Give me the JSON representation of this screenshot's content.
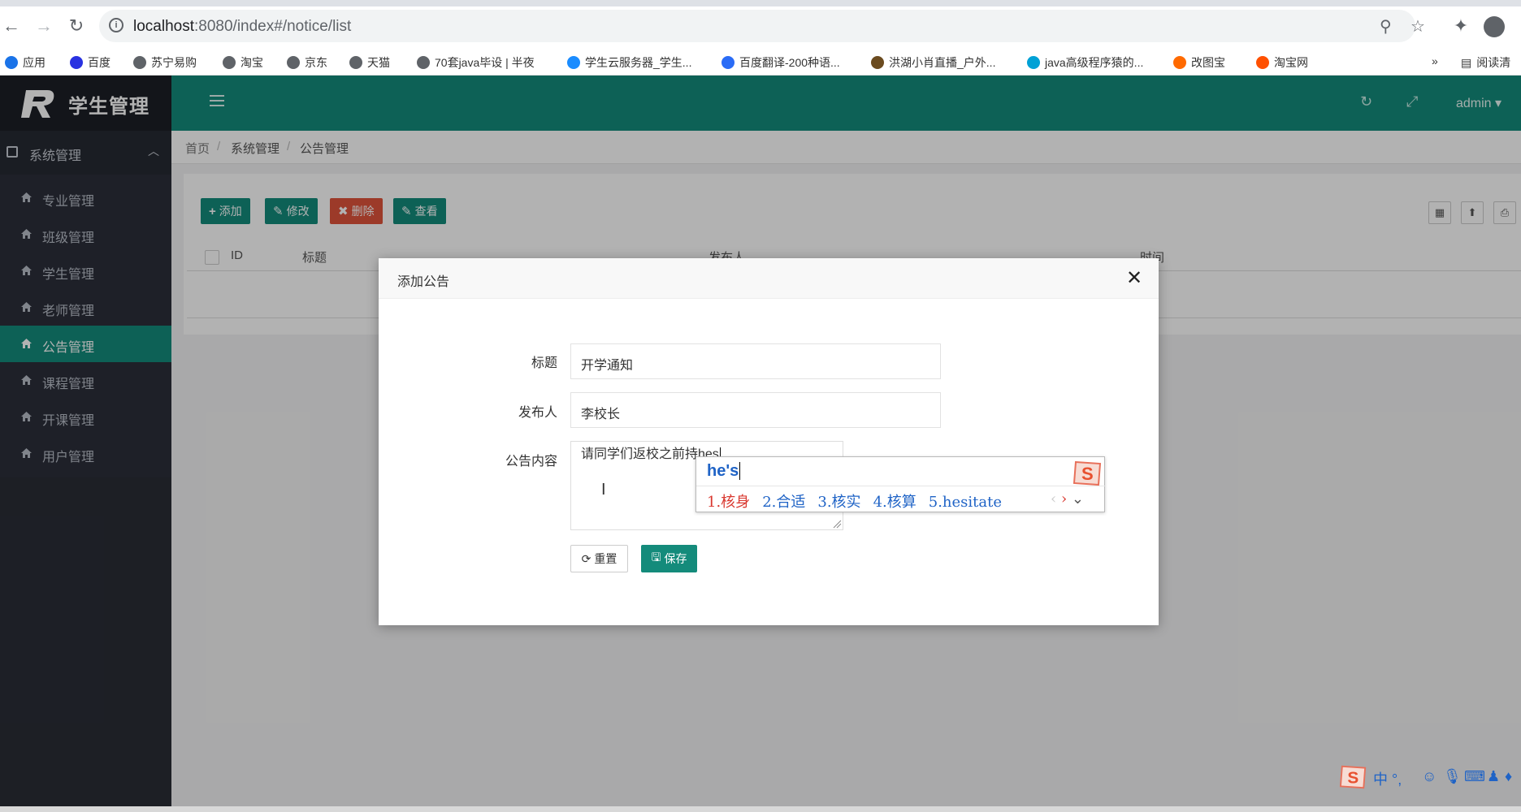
{
  "browser": {
    "url_host": "localhost",
    "url_path": ":8080/index#/notice/list",
    "bookmarks": [
      {
        "label": "应用",
        "icon": "apps-grid-icon",
        "color": "#1a73e8"
      },
      {
        "label": "百度",
        "icon": "baidu-paw-icon",
        "color": "#2932e1"
      },
      {
        "label": "苏宁易购",
        "icon": "globe-icon",
        "color": "#5f6368"
      },
      {
        "label": "淘宝",
        "icon": "globe-icon",
        "color": "#5f6368"
      },
      {
        "label": "京东",
        "icon": "globe-icon",
        "color": "#5f6368"
      },
      {
        "label": "天猫",
        "icon": "globe-icon",
        "color": "#5f6368"
      },
      {
        "label": "70套java毕设 | 半夜",
        "icon": "globe-icon",
        "color": "#5f6368"
      },
      {
        "label": "学生云服务器_学生...",
        "icon": "cloud-icon",
        "color": "#1a8cff"
      },
      {
        "label": "百度翻译-200种语...",
        "icon": "translate-icon",
        "color": "#2a6cf6"
      },
      {
        "label": "洪湖小肖直播_户外...",
        "icon": "bird-icon",
        "color": "#6b4b1f"
      },
      {
        "label": "java高级程序猿的...",
        "icon": "bilibili-icon",
        "color": "#00a1d6"
      },
      {
        "label": "改图宝",
        "icon": "photo-icon",
        "color": "#ff6a00"
      },
      {
        "label": "淘宝网",
        "icon": "taobao-icon",
        "color": "#ff5000"
      }
    ],
    "more_label": "»",
    "reading_list_label": "阅读清"
  },
  "app": {
    "brand": "学生管理",
    "user": "admin ▾"
  },
  "sidebar": {
    "group_label": "系统管理",
    "items": [
      {
        "label": "专业管理",
        "active": false
      },
      {
        "label": "班级管理",
        "active": false
      },
      {
        "label": "学生管理",
        "active": false
      },
      {
        "label": "老师管理",
        "active": false
      },
      {
        "label": "公告管理",
        "active": true
      },
      {
        "label": "课程管理",
        "active": false
      },
      {
        "label": "开课管理",
        "active": false
      },
      {
        "label": "用户管理",
        "active": false
      }
    ]
  },
  "breadcrumb": [
    "首页",
    "/",
    "系统管理",
    "/",
    "公告管理"
  ],
  "toolbar": {
    "add_label": "添加",
    "edit_label": "修改",
    "delete_label": "删除",
    "view_label": "查看"
  },
  "table": {
    "headers": [
      "ID",
      "标题",
      "发布人",
      "时间"
    ]
  },
  "modal": {
    "title": "添加公告",
    "close": "✕",
    "title_label": "标题",
    "title_value": "开学通知",
    "publisher_label": "发布人",
    "publisher_value": "李校长",
    "content_label": "公告内容",
    "content_value": "请同学们返校之前持hes",
    "reset_label": "重置",
    "save_label": "保存"
  },
  "ime": {
    "composition": "he's",
    "candidates": [
      "1.核身",
      "2.合适",
      "3.核实",
      "4.核算",
      "5.hesitate"
    ],
    "tray": "中 °,"
  },
  "colors": {
    "teal": "#148b7b",
    "sidebar_bg": "#2b2f3a",
    "danger": "#e0543c"
  }
}
